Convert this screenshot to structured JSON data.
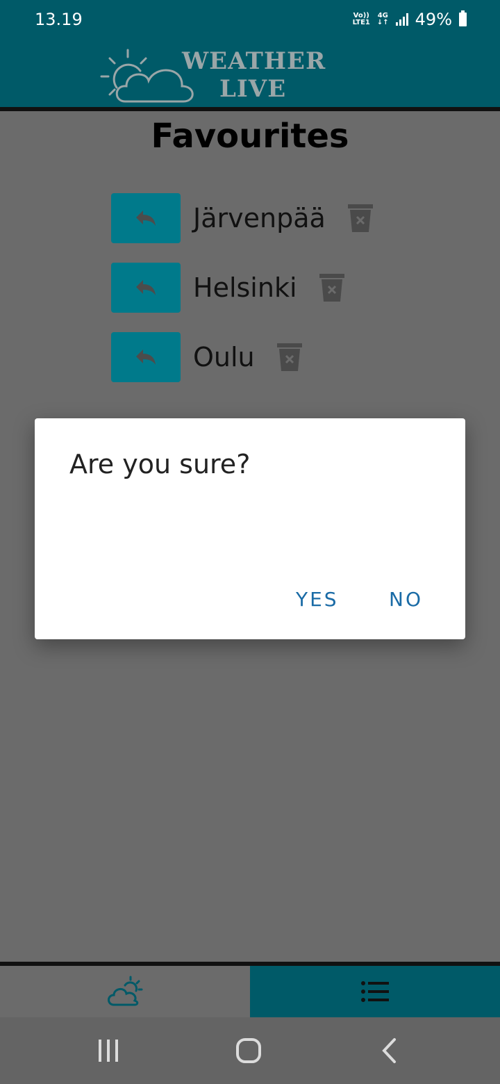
{
  "status_bar": {
    "time": "13.19",
    "network_top": "Vo))",
    "network_bottom": "LTE1",
    "network_type": "4G",
    "battery": "49%"
  },
  "header": {
    "logo_line1": "WEATHER",
    "logo_line2": "LIVE"
  },
  "page": {
    "title": "Favourites"
  },
  "favourites": [
    {
      "name": "Järvenpää"
    },
    {
      "name": "Helsinki"
    },
    {
      "name": "Oulu"
    }
  ],
  "dialog": {
    "message": "Are you sure?",
    "yes_label": "YES",
    "no_label": "NO"
  },
  "colors": {
    "primary": "#007a8b",
    "header": "#005a68",
    "dialog_button": "#1a6ba6",
    "overlay_background": "#6b6b6b"
  },
  "icons": {
    "open": "reply-arrow-icon",
    "delete": "trash-icon",
    "weather_tab": "partly-cloudy-icon",
    "favourites_tab": "list-icon"
  }
}
